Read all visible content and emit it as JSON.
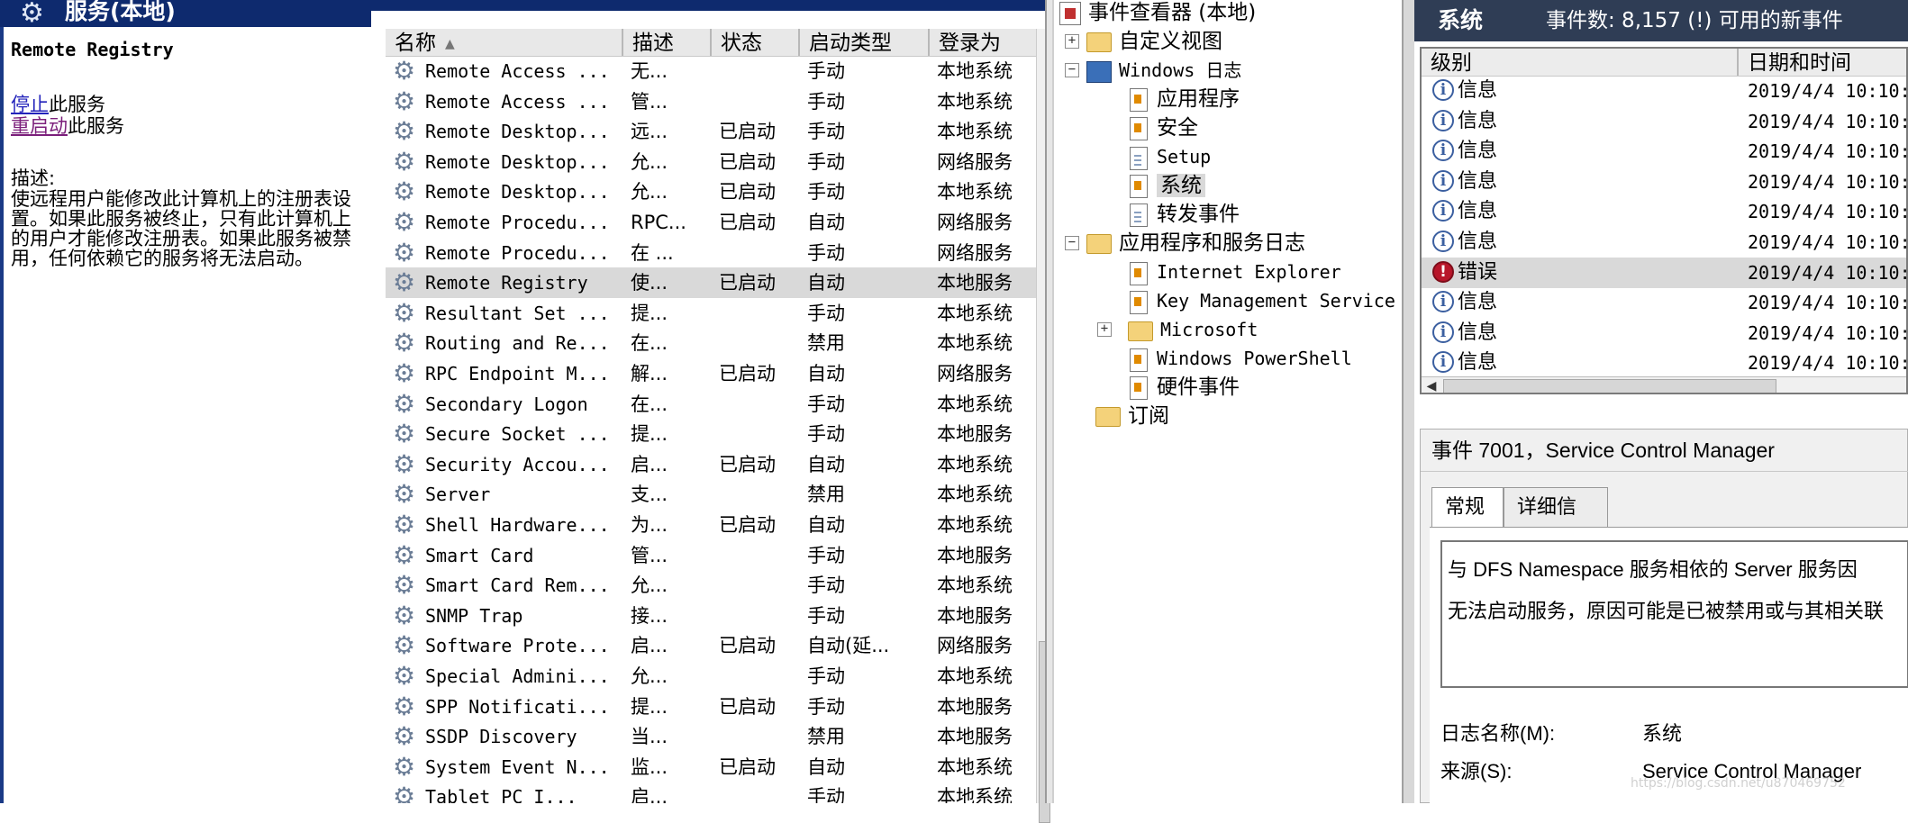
{
  "services": {
    "header_title": "服务(本地)",
    "selected_name": "Remote Registry",
    "stop_link": "停止",
    "stop_suffix": "此服务",
    "restart_link": "重启动",
    "restart_suffix": "此服务",
    "description_label": "描述:",
    "description": "使远程用户能修改此计算机上的注册表设置。如果此服务被终止，只有此计算机上的用户才能修改注册表。如果此服务被禁用，任何依赖它的服务将无法启动。",
    "columns": [
      "名称",
      "描述",
      "状态",
      "启动类型",
      "登录为"
    ],
    "rows": [
      {
        "name": "Remote Access ...",
        "desc": "无...",
        "status": "",
        "startup": "手动",
        "logon": "本地系统"
      },
      {
        "name": "Remote Access ...",
        "desc": "管...",
        "status": "",
        "startup": "手动",
        "logon": "本地系统"
      },
      {
        "name": "Remote Desktop...",
        "desc": "远...",
        "status": "已启动",
        "startup": "手动",
        "logon": "本地系统"
      },
      {
        "name": "Remote Desktop...",
        "desc": "允...",
        "status": "已启动",
        "startup": "手动",
        "logon": "网络服务"
      },
      {
        "name": "Remote Desktop...",
        "desc": "允...",
        "status": "已启动",
        "startup": "手动",
        "logon": "本地系统"
      },
      {
        "name": "Remote Procedu...",
        "desc": "RPC...",
        "status": "已启动",
        "startup": "自动",
        "logon": "网络服务"
      },
      {
        "name": "Remote Procedu...",
        "desc": "在 ...",
        "status": "",
        "startup": "手动",
        "logon": "网络服务"
      },
      {
        "name": "Remote Registry",
        "desc": "使...",
        "status": "已启动",
        "startup": "自动",
        "logon": "本地服务"
      },
      {
        "name": "Resultant Set ...",
        "desc": "提...",
        "status": "",
        "startup": "手动",
        "logon": "本地系统"
      },
      {
        "name": "Routing and Re...",
        "desc": "在...",
        "status": "",
        "startup": "禁用",
        "logon": "本地系统"
      },
      {
        "name": "RPC Endpoint M...",
        "desc": "解...",
        "status": "已启动",
        "startup": "自动",
        "logon": "网络服务"
      },
      {
        "name": "Secondary Logon",
        "desc": "在...",
        "status": "",
        "startup": "手动",
        "logon": "本地系统"
      },
      {
        "name": "Secure Socket ...",
        "desc": "提...",
        "status": "",
        "startup": "手动",
        "logon": "本地服务"
      },
      {
        "name": "Security Accou...",
        "desc": "启...",
        "status": "已启动",
        "startup": "自动",
        "logon": "本地系统"
      },
      {
        "name": "Server",
        "desc": "支...",
        "status": "",
        "startup": "禁用",
        "logon": "本地系统"
      },
      {
        "name": "Shell Hardware...",
        "desc": "为...",
        "status": "已启动",
        "startup": "自动",
        "logon": "本地系统"
      },
      {
        "name": "Smart Card",
        "desc": "管...",
        "status": "",
        "startup": "手动",
        "logon": "本地服务"
      },
      {
        "name": "Smart Card Rem...",
        "desc": "允...",
        "status": "",
        "startup": "手动",
        "logon": "本地系统"
      },
      {
        "name": "SNMP Trap",
        "desc": "接...",
        "status": "",
        "startup": "手动",
        "logon": "本地服务"
      },
      {
        "name": "Software Prote...",
        "desc": "启...",
        "status": "已启动",
        "startup": "自动(延...",
        "logon": "网络服务"
      },
      {
        "name": "Special Admini...",
        "desc": "允...",
        "status": "",
        "startup": "手动",
        "logon": "本地系统"
      },
      {
        "name": "SPP Notificati...",
        "desc": "提...",
        "status": "已启动",
        "startup": "手动",
        "logon": "本地服务"
      },
      {
        "name": "SSDP Discovery",
        "desc": "当...",
        "status": "",
        "startup": "禁用",
        "logon": "本地服务"
      },
      {
        "name": "System Event N...",
        "desc": "监...",
        "status": "已启动",
        "startup": "自动",
        "logon": "本地系统"
      },
      {
        "name": "Tablet PC I...",
        "desc": "启...",
        "status": "",
        "startup": "手动",
        "logon": "本地系统"
      }
    ]
  },
  "tree": {
    "root": "事件查看器 (本地)",
    "custom_views": "自定义视图",
    "windows_logs": "Windows 日志",
    "application": "应用程序",
    "security": "安全",
    "setup": "Setup",
    "system": "系统",
    "forwarded": "转发事件",
    "app_service_logs": "应用程序和服务日志",
    "internet_explorer": "Internet Explorer",
    "key_management": "Key Management Service",
    "microsoft": "Microsoft",
    "powershell": "Windows PowerShell",
    "hardware_events": "硬件事件",
    "subscriptions": "订阅"
  },
  "events": {
    "log_name": "系统",
    "count_text": "事件数: 8,157 (!) 可用的新事件",
    "columns": [
      "级别",
      "日期和时间"
    ],
    "rows": [
      {
        "level": "信息",
        "type": "info",
        "datetime": "2019/4/4 10:10:"
      },
      {
        "level": "信息",
        "type": "info",
        "datetime": "2019/4/4 10:10:"
      },
      {
        "level": "信息",
        "type": "info",
        "datetime": "2019/4/4 10:10:"
      },
      {
        "level": "信息",
        "type": "info",
        "datetime": "2019/4/4 10:10:"
      },
      {
        "level": "信息",
        "type": "info",
        "datetime": "2019/4/4 10:10:"
      },
      {
        "level": "信息",
        "type": "info",
        "datetime": "2019/4/4 10:10:"
      },
      {
        "level": "错误",
        "type": "error",
        "datetime": "2019/4/4 10:10:"
      },
      {
        "level": "信息",
        "type": "info",
        "datetime": "2019/4/4 10:10:"
      },
      {
        "level": "信息",
        "type": "info",
        "datetime": "2019/4/4 10:10:"
      },
      {
        "level": "信息",
        "type": "info",
        "datetime": "2019/4/4 10:10:"
      }
    ],
    "detail_title": "事件 7001，Service Control Manager",
    "tab_general": "常规",
    "tab_details": "详细信息",
    "message_line1": "与 DFS Namespace 服务相依的 Server 服务因",
    "message_line2": "无法启动服务，原因可能是已被禁用或与其相关联",
    "log_name_label": "日志名称(M):",
    "log_name_value": "系统",
    "source_label": "来源(S):",
    "source_value": "Service Control Manager"
  },
  "watermark": "https://blog.csdn.net/u870469752"
}
